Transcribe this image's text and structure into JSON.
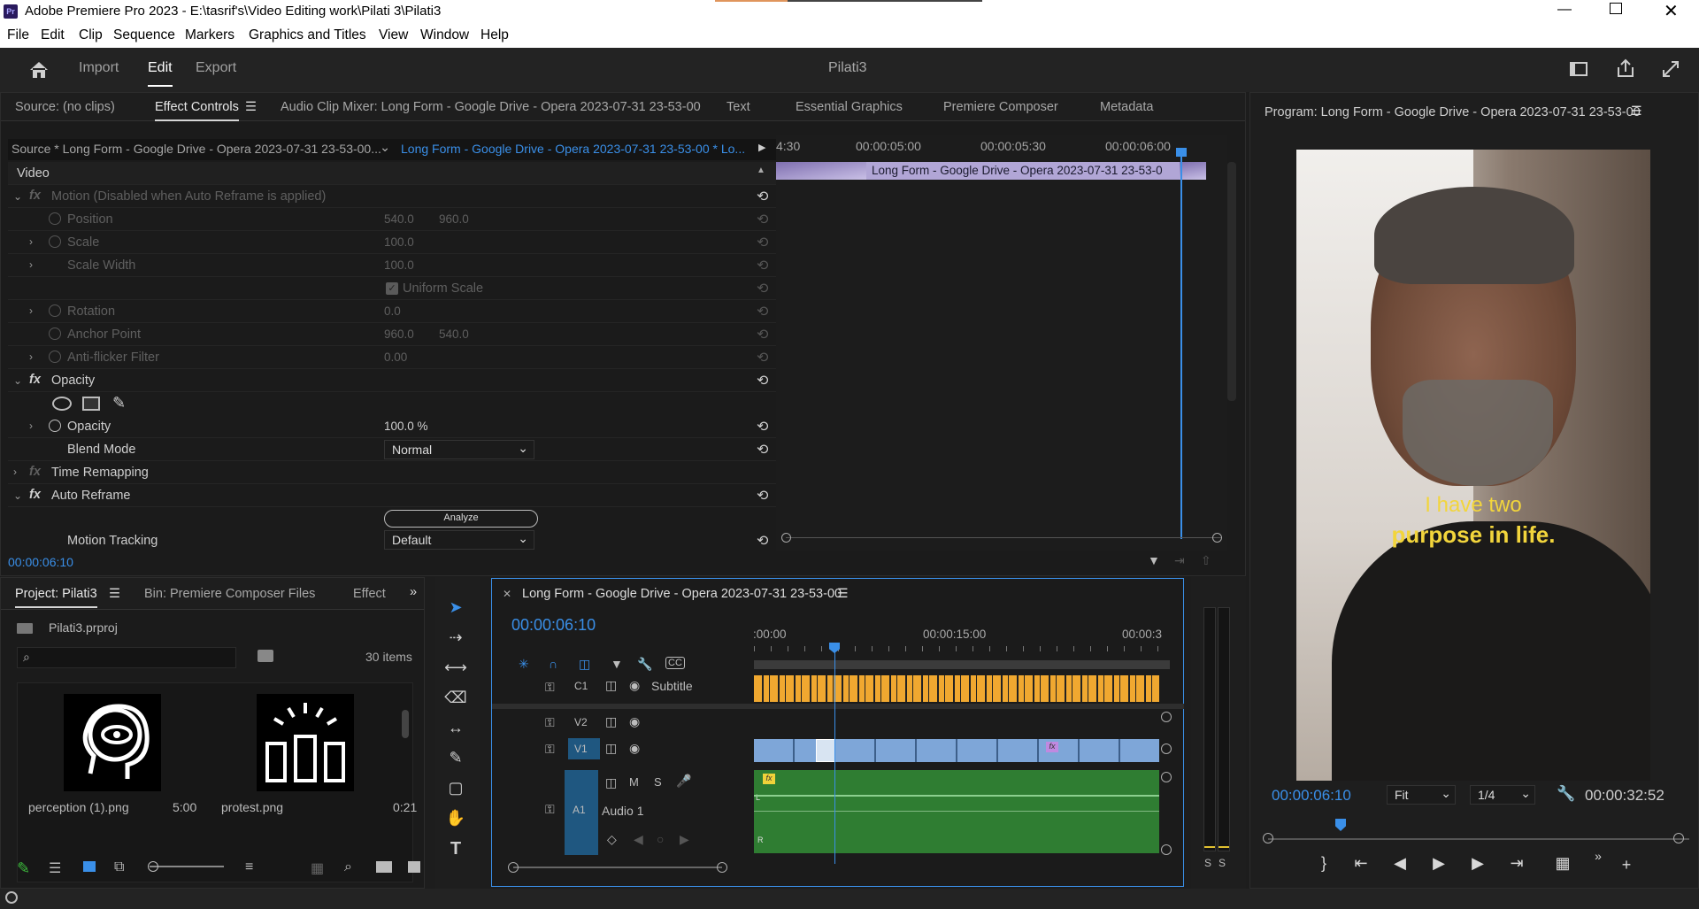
{
  "window": {
    "title": "Adobe Premiere Pro 2023 - E:\\tasrif's\\Video Editing work\\Pilati 3\\Pilati3",
    "app_badge": "Pr"
  },
  "menu": [
    "File",
    "Edit",
    "Clip",
    "Sequence",
    "Markers",
    "Graphics and Titles",
    "View",
    "Window",
    "Help"
  ],
  "workspace": {
    "import": "Import",
    "edit": "Edit",
    "export": "Export",
    "project_name": "Pilati3"
  },
  "source_tabs": {
    "source": "Source: (no clips)",
    "effect_controls": "Effect Controls",
    "audio_mixer": "Audio Clip Mixer: Long Form - Google Drive - Opera 2023-07-31 23-53-00",
    "text": "Text",
    "essential_graphics": "Essential Graphics",
    "premiere_composer": "Premiere Composer",
    "metadata": "Metadata"
  },
  "effect_controls": {
    "source_select": "Source * Long Form - Google Drive - Opera 2023-07-31 23-53-00...",
    "clip_select": "Long Form - Google Drive - Opera 2023-07-31 23-53-00 * Lo...",
    "video_label": "Video",
    "motion": "Motion  (Disabled when Auto Reframe is applied)",
    "position": "Position",
    "position_x": "540.0",
    "position_y": "960.0",
    "scale": "Scale",
    "scale_val": "100.0",
    "scale_width": "Scale Width",
    "scale_width_val": "100.0",
    "uniform_scale": "Uniform Scale",
    "rotation": "Rotation",
    "rotation_val": "0.0",
    "anchor": "Anchor Point",
    "anchor_x": "960.0",
    "anchor_y": "540.0",
    "antiflicker": "Anti-flicker Filter",
    "antiflicker_val": "0.00",
    "opacity_section": "Opacity",
    "opacity": "Opacity",
    "opacity_val": "100.0 %",
    "blend_mode": "Blend Mode",
    "blend_val": "Normal",
    "time_remap": "Time Remapping",
    "auto_reframe": "Auto Reframe",
    "analyze": "Analyze",
    "motion_tracking": "Motion Tracking",
    "motion_tracking_val": "Default",
    "timecode": "00:00:06:10",
    "ruler": [
      "4:30",
      "00:00:05:00",
      "00:00:05:30",
      "00:00:06:00"
    ],
    "clip_label": "Long Form - Google Drive - Opera 2023-07-31 23-53-0"
  },
  "program": {
    "title": "Program: Long Form - Google Drive - Opera 2023-07-31 23-53-00",
    "caption_line1": "I have two",
    "caption_line2": "purpose in life.",
    "timecode": "00:00:06:10",
    "fit": "Fit",
    "resolution": "1/4",
    "duration": "00:00:32:52"
  },
  "project": {
    "tab": "Project: Pilati3",
    "bin": "Bin: Premiere Composer Files",
    "effects": "Effect",
    "file": "Pilati3.prproj",
    "items_count": "30 items",
    "search_placeholder": "",
    "items": [
      {
        "name": "perception (1).png",
        "duration": "5:00"
      },
      {
        "name": "protest.png",
        "duration": "0:21"
      }
    ]
  },
  "timeline": {
    "title": "Long Form - Google Drive - Opera 2023-07-31 23-53-00",
    "timecode": "00:00:06:10",
    "ruler": [
      ":00:00",
      "00:00:15:00",
      "00:00:3"
    ],
    "tracks": {
      "c1": "C1",
      "subtitle": "Subtitle",
      "v2": "V2",
      "v1": "V1",
      "a1": "A1",
      "audio1": "Audio 1",
      "m": "M",
      "s": "S",
      "l": "L",
      "r": "R",
      "fx": "fx"
    }
  },
  "meter": {
    "s1": "S",
    "s2": "S"
  },
  "colors": {
    "accent": "#2d8ceb",
    "caption_yellow": "#f0d23a",
    "video_clip": "#7ea6d8",
    "subtitle_clip": "#f0a830",
    "audio_clip": "#2f7d32"
  }
}
